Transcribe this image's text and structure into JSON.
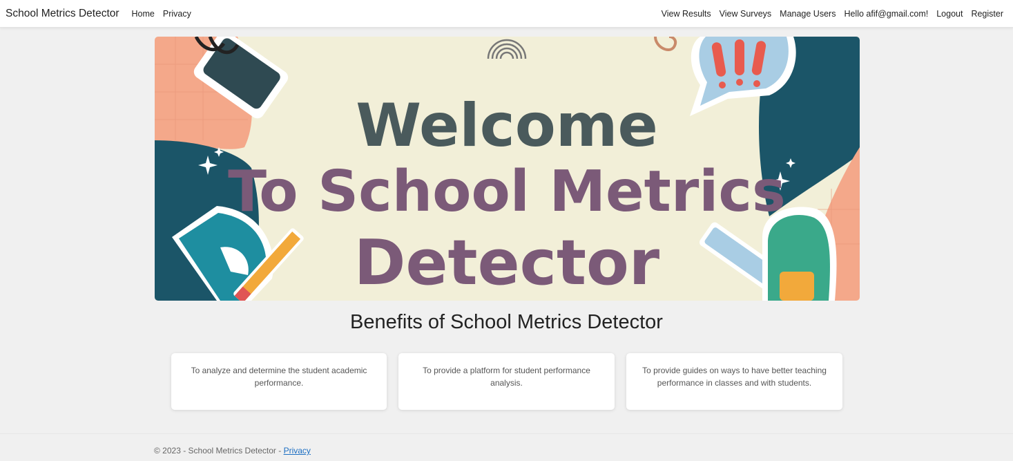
{
  "navbar": {
    "brand": "School Metrics Detector",
    "left_links": [
      "Home",
      "Privacy"
    ],
    "right_links": [
      "View Results",
      "View Surveys",
      "Manage Users",
      "Hello afif@gmail.com!",
      "Logout",
      "Register"
    ]
  },
  "hero": {
    "line1": "Welcome",
    "line2": "To School Metrics",
    "line3": "Detector",
    "colors": {
      "background": "#f2efd8",
      "teal": "#1b5568",
      "peach": "#f4a88a",
      "welcome_text": "#4a5a5c",
      "title_text": "#7b5a78"
    },
    "icons": [
      "binder-clip-icon",
      "speech-bubble-exclamation-icon",
      "rainbow-icon",
      "protractor-icon",
      "pencil-icon",
      "ruler-icon",
      "backpack-icon",
      "paperclip-icon",
      "sparkle-icon"
    ]
  },
  "benefits": {
    "title": "Benefits of School Metrics Detector",
    "cards": [
      "To analyze and determine the student academic performance.",
      "To provide a platform for student performance analysis.",
      "To provide guides on ways to have better teaching performance in classes and with students."
    ]
  },
  "footer": {
    "text": "© 2023 - School Metrics Detector - ",
    "link": "Privacy"
  }
}
